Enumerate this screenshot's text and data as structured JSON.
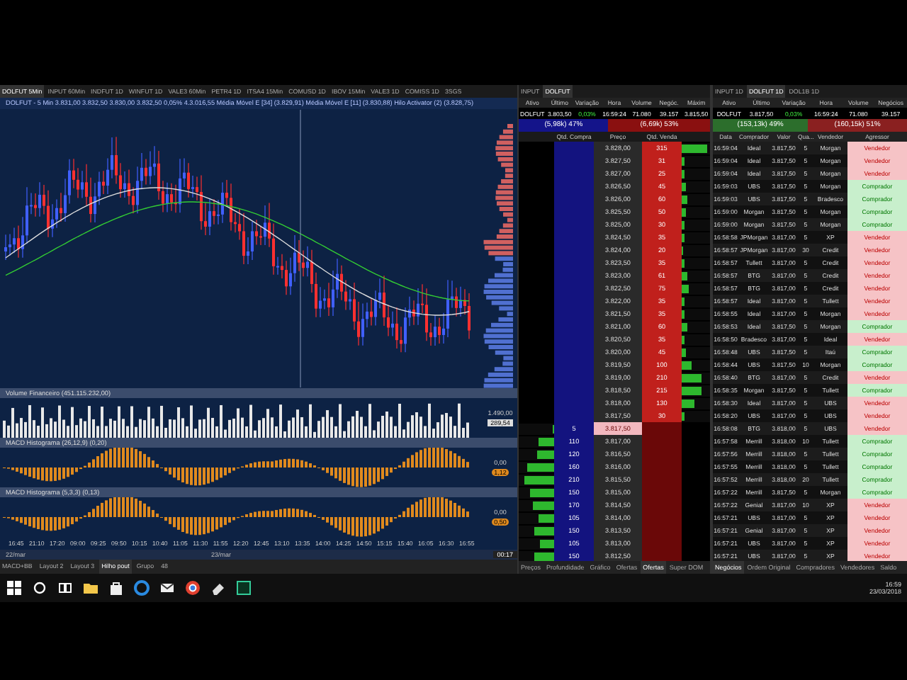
{
  "chart_window": {
    "tabs": [
      {
        "label": "DOLFUT 5Min",
        "selected": true
      },
      {
        "label": "INPUT 60Min",
        "selected": false
      },
      {
        "label": "INDFUT 1D",
        "selected": false
      },
      {
        "label": "WINFUT 1D",
        "selected": false
      },
      {
        "label": "VALE3 60Min",
        "selected": false
      },
      {
        "label": "PETR4 1D",
        "selected": false
      },
      {
        "label": "ITSA4 15Min",
        "selected": false
      },
      {
        "label": "COMUSD 1D",
        "selected": false
      },
      {
        "label": "IBOV 15Min",
        "selected": false
      },
      {
        "label": "VALE3 1D",
        "selected": false
      },
      {
        "label": "COMISS 1D",
        "selected": false
      },
      {
        "label": "3SGS",
        "selected": false
      }
    ],
    "legend": "DOLFUT - 5 Min  3.831,00  3.832,50  3.830,00  3.832,50  0,05%  4.3.016,55  Média Móvel E [34] (3.829,91)  Média Móvel E [11] (3.830,88)  Hilo Activator (2) (3.828,75)",
    "panels": [
      {
        "title": "Volume Financeiro (451.115.232,00)",
        "kind": "volume",
        "axis_label": "1.490,00",
        "value_badge": "289,54"
      },
      {
        "title": "MACD Histograma (26,12,9) (0,20)",
        "kind": "histogram",
        "axis_label": "0,00",
        "value_badge": "1,12"
      },
      {
        "title": "MACD Histograma (5,3,3) (0,13)",
        "kind": "histogram",
        "axis_label": "0,00",
        "value_badge": "0,50"
      }
    ],
    "time_labels": [
      "16:45",
      "21:10",
      "17:20",
      "09:00",
      "09:25",
      "09:50",
      "10:15",
      "10:40",
      "11:05",
      "11:30",
      "11:55",
      "12:20",
      "12:45",
      "13:10",
      "13:35",
      "14:00",
      "14:25",
      "14:50",
      "15:15",
      "15:40",
      "16:05",
      "16:30",
      "16:55"
    ],
    "dates": [
      "22/mar",
      "23/mar"
    ],
    "corner_time": "00:17",
    "layout_tabs": [
      {
        "label": "MACD+BB",
        "selected": false
      },
      {
        "label": "Layout 2",
        "selected": false
      },
      {
        "label": "Layout 3",
        "selected": false
      },
      {
        "label": "Hilho pout",
        "selected": true
      },
      {
        "label": "Grupo",
        "selected": false
      },
      {
        "label": "48",
        "selected": false
      }
    ]
  },
  "book_window": {
    "tabs": [
      {
        "label": "INPUT",
        "selected": false
      },
      {
        "label": "DOLFUT",
        "selected": true
      }
    ],
    "columns": [
      "Ativo",
      "Último",
      "Variação",
      "Hora",
      "Volume",
      "Negóc.",
      "Máxim"
    ],
    "quote": [
      "DOLFUT",
      "3.803,50",
      "0,03%",
      "16:59:24",
      "71.080",
      "39.157",
      "3.815,50"
    ],
    "buy_share": "(5,98k) 47%",
    "sell_share": "(6,69k) 53%",
    "book_columns": [
      "Qtd. Compra",
      "Preço",
      "Qtd. Venda"
    ],
    "rows": [
      {
        "kind": "ask",
        "price": "3.828,00",
        "qty": "315",
        "level": 0.9
      },
      {
        "kind": "ask",
        "price": "3.827,50",
        "qty": "31",
        "level": 0.1
      },
      {
        "kind": "ask",
        "price": "3.827,00",
        "qty": "25",
        "level": 0.08
      },
      {
        "kind": "ask",
        "price": "3.826,50",
        "qty": "45",
        "level": 0.15
      },
      {
        "kind": "ask",
        "price": "3.826,00",
        "qty": "60",
        "level": 0.2
      },
      {
        "kind": "ask",
        "price": "3.825,50",
        "qty": "50",
        "level": 0.17
      },
      {
        "kind": "ask",
        "price": "3.825,00",
        "qty": "30",
        "level": 0.1
      },
      {
        "kind": "ask",
        "price": "3.824,50",
        "qty": "35",
        "level": 0.12
      },
      {
        "kind": "ask",
        "price": "3.824,00",
        "qty": "20",
        "level": 0.07
      },
      {
        "kind": "ask",
        "price": "3.823,50",
        "qty": "35",
        "level": 0.12
      },
      {
        "kind": "ask",
        "price": "3.823,00",
        "qty": "61",
        "level": 0.2
      },
      {
        "kind": "ask",
        "price": "3.822,50",
        "qty": "75",
        "level": 0.25
      },
      {
        "kind": "ask",
        "price": "3.822,00",
        "qty": "35",
        "level": 0.12
      },
      {
        "kind": "ask",
        "price": "3.821,50",
        "qty": "35",
        "level": 0.12
      },
      {
        "kind": "ask",
        "price": "3.821,00",
        "qty": "60",
        "level": 0.2
      },
      {
        "kind": "ask",
        "price": "3.820,50",
        "qty": "35",
        "level": 0.12
      },
      {
        "kind": "ask",
        "price": "3.820,00",
        "qty": "45",
        "level": 0.15
      },
      {
        "kind": "ask",
        "price": "3.819,50",
        "qty": "100",
        "level": 0.33
      },
      {
        "kind": "ask",
        "price": "3.819,00",
        "qty": "210",
        "level": 0.7
      },
      {
        "kind": "ask",
        "price": "3.818,50",
        "qty": "215",
        "level": 0.72
      },
      {
        "kind": "ask",
        "price": "3.818,00",
        "qty": "130",
        "level": 0.45
      },
      {
        "kind": "ask",
        "price": "3.817,50",
        "qty": "30",
        "level": 0.1
      },
      {
        "kind": "best",
        "price": "3.817,50",
        "qty": "5",
        "level": 0.05
      },
      {
        "kind": "bid",
        "price": "3.817,00",
        "qty": "110",
        "level": 0.45
      },
      {
        "kind": "bid",
        "price": "3.816,50",
        "qty": "120",
        "level": 0.5
      },
      {
        "kind": "bid",
        "price": "3.816,00",
        "qty": "160",
        "level": 0.75
      },
      {
        "kind": "bid",
        "price": "3.815,50",
        "qty": "210",
        "level": 0.85
      },
      {
        "kind": "bid",
        "price": "3.815,00",
        "qty": "150",
        "level": 0.7
      },
      {
        "kind": "bid",
        "price": "3.814,50",
        "qty": "170",
        "level": 0.6
      },
      {
        "kind": "bid",
        "price": "3.814,00",
        "qty": "105",
        "level": 0.45
      },
      {
        "kind": "bid",
        "price": "3.813,50",
        "qty": "150",
        "level": 0.55
      },
      {
        "kind": "bid",
        "price": "3.813,00",
        "qty": "105",
        "level": 0.4
      },
      {
        "kind": "bid",
        "price": "3.812,50",
        "qty": "150",
        "level": 0.55
      }
    ],
    "bottom_tabs": [
      {
        "label": "Preços",
        "selected": false
      },
      {
        "label": "Profundidade",
        "selected": false
      },
      {
        "label": "Gráfico",
        "selected": false
      },
      {
        "label": "Ofertas",
        "selected": false
      },
      {
        "label": "Ofertas",
        "selected": true
      },
      {
        "label": "Super DOM",
        "selected": false
      }
    ]
  },
  "trades_window": {
    "tabs": [
      {
        "label": "INPUT 1D",
        "selected": false
      },
      {
        "label": "DOLFUT 1D",
        "selected": true
      },
      {
        "label": "DOL1B 1D",
        "selected": false
      }
    ],
    "columns": [
      "Ativo",
      "Último",
      "Variação",
      "Hora",
      "Volume",
      "Negócios"
    ],
    "quote": [
      "DOLFUT",
      "3.817,50",
      "0,03%",
      "16:59:24",
      "71.080",
      "39.157"
    ],
    "buy_share": "(153,13k) 49%",
    "sell_share": "(160,15k) 51%",
    "trade_columns": [
      "Data",
      "Comprador",
      "Valor",
      "Qua...",
      "Vendedor",
      "Agressor"
    ],
    "rows": [
      {
        "kind": "sell",
        "time": "16:59:04",
        "buyer": "Ideal",
        "value": "3.817,50",
        "qty": "5",
        "seller": "Morgan",
        "aggressor": "Vendedor"
      },
      {
        "kind": "sell",
        "time": "16:59:04",
        "buyer": "Ideal",
        "value": "3.817,50",
        "qty": "5",
        "seller": "Morgan",
        "aggressor": "Vendedor"
      },
      {
        "kind": "sell",
        "time": "16:59:04",
        "buyer": "Ideal",
        "value": "3.817,50",
        "qty": "5",
        "seller": "Morgan",
        "aggressor": "Vendedor"
      },
      {
        "kind": "buy",
        "time": "16:59:03",
        "buyer": "UBS",
        "value": "3.817,50",
        "qty": "5",
        "seller": "Morgan",
        "aggressor": "Comprador"
      },
      {
        "kind": "buy",
        "time": "16:59:03",
        "buyer": "UBS",
        "value": "3.817,50",
        "qty": "5",
        "seller": "Bradesco",
        "aggressor": "Comprador"
      },
      {
        "kind": "buy",
        "time": "16:59:00",
        "buyer": "Morgan",
        "value": "3.817,50",
        "qty": "5",
        "seller": "Morgan",
        "aggressor": "Comprador"
      },
      {
        "kind": "buy",
        "time": "16:59:00",
        "buyer": "Morgan",
        "value": "3.817,50",
        "qty": "5",
        "seller": "Morgan",
        "aggressor": "Comprador"
      },
      {
        "kind": "sell",
        "time": "16:58:58",
        "buyer": "JPMorgan",
        "value": "3.817,00",
        "qty": "5",
        "seller": "XP",
        "aggressor": "Vendedor"
      },
      {
        "kind": "sell",
        "time": "16:58:57",
        "buyer": "JPMorgan",
        "value": "3.817,00",
        "qty": "30",
        "seller": "Credit",
        "aggressor": "Vendedor"
      },
      {
        "kind": "sell",
        "time": "16:58:57",
        "buyer": "Tullett",
        "value": "3.817,00",
        "qty": "5",
        "seller": "Credit",
        "aggressor": "Vendedor"
      },
      {
        "kind": "sell",
        "time": "16:58:57",
        "buyer": "BTG",
        "value": "3.817,00",
        "qty": "5",
        "seller": "Credit",
        "aggressor": "Vendedor"
      },
      {
        "kind": "sell",
        "time": "16:58:57",
        "buyer": "BTG",
        "value": "3.817,00",
        "qty": "5",
        "seller": "Credit",
        "aggressor": "Vendedor"
      },
      {
        "kind": "sell",
        "time": "16:58:57",
        "buyer": "Ideal",
        "value": "3.817,00",
        "qty": "5",
        "seller": "Tullett",
        "aggressor": "Vendedor"
      },
      {
        "kind": "sell",
        "time": "16:58:55",
        "buyer": "Ideal",
        "value": "3.817,00",
        "qty": "5",
        "seller": "Morgan",
        "aggressor": "Vendedor"
      },
      {
        "kind": "buy",
        "time": "16:58:53",
        "buyer": "Ideal",
        "value": "3.817,50",
        "qty": "5",
        "seller": "Morgan",
        "aggressor": "Comprador"
      },
      {
        "kind": "sell",
        "time": "16:58:50",
        "buyer": "Bradesco",
        "value": "3.817,00",
        "qty": "5",
        "seller": "Ideal",
        "aggressor": "Vendedor"
      },
      {
        "kind": "buy",
        "time": "16:58:48",
        "buyer": "UBS",
        "value": "3.817,50",
        "qty": "5",
        "seller": "Itaú",
        "aggressor": "Comprador"
      },
      {
        "kind": "buy",
        "time": "16:58:44",
        "buyer": "UBS",
        "value": "3.817,50",
        "qty": "10",
        "seller": "Morgan",
        "aggressor": "Comprador"
      },
      {
        "kind": "sell",
        "time": "16:58:40",
        "buyer": "BTG",
        "value": "3.817,00",
        "qty": "5",
        "seller": "Credit",
        "aggressor": "Vendedor"
      },
      {
        "kind": "buy",
        "time": "16:58:35",
        "buyer": "Morgan",
        "value": "3.817,50",
        "qty": "5",
        "seller": "Tullett",
        "aggressor": "Comprador"
      },
      {
        "kind": "sell",
        "time": "16:58:30",
        "buyer": "Ideal",
        "value": "3.817,00",
        "qty": "5",
        "seller": "UBS",
        "aggressor": "Vendedor"
      },
      {
        "kind": "sell",
        "time": "16:58:20",
        "buyer": "UBS",
        "value": "3.817,00",
        "qty": "5",
        "seller": "UBS",
        "aggressor": "Vendedor"
      },
      {
        "kind": "sell",
        "time": "16:58:08",
        "buyer": "BTG",
        "value": "3.818,00",
        "qty": "5",
        "seller": "UBS",
        "aggressor": "Vendedor"
      },
      {
        "kind": "buy",
        "time": "16:57:58",
        "buyer": "Merrill",
        "value": "3.818,00",
        "qty": "10",
        "seller": "Tullett",
        "aggressor": "Comprador"
      },
      {
        "kind": "buy",
        "time": "16:57:56",
        "buyer": "Merrill",
        "value": "3.818,00",
        "qty": "5",
        "seller": "Tullett",
        "aggressor": "Comprador"
      },
      {
        "kind": "buy",
        "time": "16:57:55",
        "buyer": "Merrill",
        "value": "3.818,00",
        "qty": "5",
        "seller": "Tullett",
        "aggressor": "Comprador"
      },
      {
        "kind": "buy",
        "time": "16:57:52",
        "buyer": "Merrill",
        "value": "3.818,00",
        "qty": "20",
        "seller": "Tullett",
        "aggressor": "Comprador"
      },
      {
        "kind": "buy",
        "time": "16:57:22",
        "buyer": "Merrill",
        "value": "3.817,50",
        "qty": "5",
        "seller": "Morgan",
        "aggressor": "Comprador"
      },
      {
        "kind": "sell",
        "time": "16:57:22",
        "buyer": "Genial",
        "value": "3.817,00",
        "qty": "10",
        "seller": "XP",
        "aggressor": "Vendedor"
      },
      {
        "kind": "sell",
        "time": "16:57:21",
        "buyer": "UBS",
        "value": "3.817,00",
        "qty": "5",
        "seller": "XP",
        "aggressor": "Vendedor"
      },
      {
        "kind": "sell",
        "time": "16:57:21",
        "buyer": "Genial",
        "value": "3.817,00",
        "qty": "5",
        "seller": "XP",
        "aggressor": "Vendedor"
      },
      {
        "kind": "sell",
        "time": "16:57:21",
        "buyer": "UBS",
        "value": "3.817,00",
        "qty": "5",
        "seller": "XP",
        "aggressor": "Vendedor"
      },
      {
        "kind": "sell",
        "time": "16:57:21",
        "buyer": "UBS",
        "value": "3.817,00",
        "qty": "5",
        "seller": "XP",
        "aggressor": "Vendedor"
      }
    ],
    "bottom_tabs": [
      {
        "label": "Negócios",
        "selected": true
      },
      {
        "label": "Ordem Original",
        "selected": false
      },
      {
        "label": "Compradores",
        "selected": false
      },
      {
        "label": "Vendedores",
        "selected": false
      },
      {
        "label": "Saldo",
        "selected": false
      }
    ]
  },
  "taskbar": {
    "time": "16:59",
    "date": "23/03/2018"
  }
}
